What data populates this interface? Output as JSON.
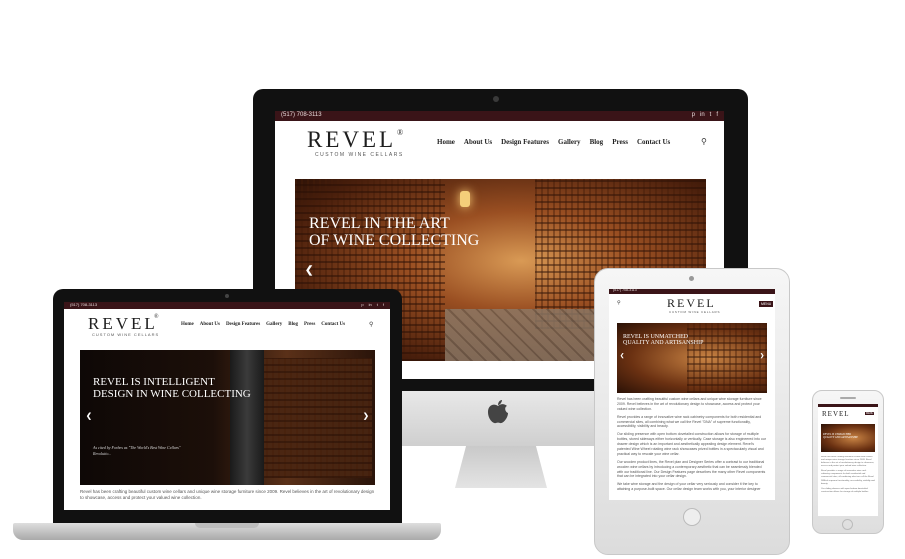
{
  "site": {
    "phone": "(517) 708-3113",
    "logo": "REVEL",
    "logo_mark": "®",
    "tagline": "CUSTOM WINE CELLARS",
    "menu_label": "MENU",
    "nav": [
      "Home",
      "About Us",
      "Design Features",
      "Gallery",
      "Blog",
      "Press",
      "Contact Us"
    ],
    "social": [
      "p",
      "in",
      "t",
      "f"
    ]
  },
  "desktop": {
    "hero_line1": "Revel in the Art",
    "hero_line2": "of Wine Collecting"
  },
  "laptop": {
    "hero_line1": "Revel is Intelligent",
    "hero_line2": "Design in Wine Collecting",
    "quote_line1": "As cited by Forbes as \"The World's Best Wine Cellars\"",
    "quote_line2": "Revolutio...",
    "body_text": "Revel has been crafting beautiful custom wine cellars and unique wine storage furniture since 2009. Revel believes in the art of revolutionary design to showcase, access and protect your valued wine collection."
  },
  "tablet": {
    "hero_line1": "Revel is Unmatched",
    "hero_line2": "Quality and Artisanship",
    "paragraphs": [
      "Revel has been crafting beautiful custom wine cellars and unique wine storage furniture since 2009. Revel believes in the art of revolutionary design to showcase, access and protect your valued wine collection.",
      "Revel provides a range of innovative wine rack cabinetry components for both residential and commercial sites, all combining what we call the Revel \"DNA\" of supreme functionality, accessibility, visibility and beauty.",
      "Our sliding presence with open bottom dovetailed construction allows for storage of multiple bottles, stored sideways either horizontally or vertically. Case storage is also engineered into our drawer design which is an important and aesthetically appealing design element. Revel's patented Wine Wheel rotating wine rack showcases prized bottles in a spectacularly visual and practical way to rescale your wine cellar.",
      "Our wooden product lines, the Revel plan and Designer Series offer a contrast to our traditional wooden wine cellars by introducing a contemporary aesthetic that can be seamlessly blended with our traditional line. Our Design Features page describes the many other Revel components that can be integrated into your cellar design.",
      "We take wine storage and the design of your cellar very seriously and consider it the key to attaining a purpose-built space. Our cellar design team works with you, your interior designer"
    ]
  },
  "phone": {
    "hero_line1": "Revel is Unmatched",
    "hero_line2": "Quality and Artisanship",
    "paragraphs": [
      "Revel has been crafting beautiful custom wine cellars and unique wine storage furniture since 2009. Revel believes in the art of revolutionary design to showcase, access and protect your valued wine collection.",
      "Revel provides a range of innovative wine rack cabinetry components for both residential and commercial sites, all combining what we call the Revel DNA of supreme functionality, accessibility, visibility and beauty.",
      "Our sliding drawers with open bottom dovetailed construction allows for storage of multiple bottles."
    ]
  },
  "colors": {
    "brand_maroon": "#3a1418",
    "wood": "#a85a2a",
    "device_black": "#111111",
    "device_silver": "#d9d9d9"
  },
  "icons": {
    "search": "search-icon",
    "prev": "chevron-left-icon",
    "next": "chevron-right-icon",
    "apple": "apple-logo-icon",
    "home_button": "home-button-icon"
  }
}
